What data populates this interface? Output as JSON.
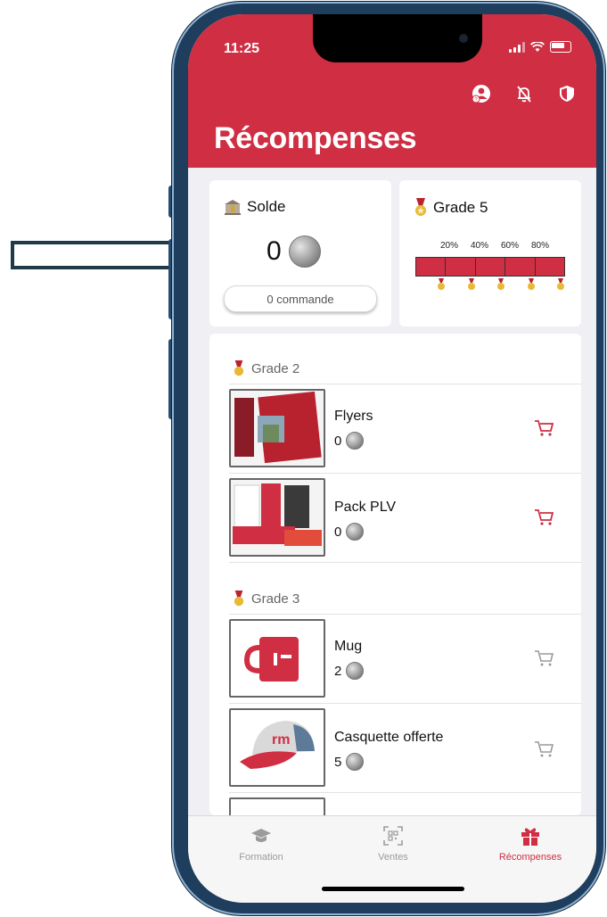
{
  "status_bar": {
    "time": "11:25"
  },
  "header": {
    "title": "Récompenses",
    "icons": [
      "help-person-icon",
      "notifications-off-icon",
      "shield-icon"
    ]
  },
  "solde_card": {
    "label": "Solde",
    "balance": "0",
    "orders_button": "0 commande"
  },
  "grade_card": {
    "label": "Grade 5",
    "percent_labels": [
      "20%",
      "40%",
      "60%",
      "80%"
    ],
    "progress_fraction": 1.0
  },
  "groups": [
    {
      "label": "Grade 2",
      "products": [
        {
          "name": "Flyers",
          "price": "0",
          "cart_active": true
        },
        {
          "name": "Pack PLV",
          "price": "0",
          "cart_active": true
        }
      ]
    },
    {
      "label": "Grade 3",
      "products": [
        {
          "name": "Mug",
          "price": "2",
          "cart_active": false
        },
        {
          "name": "Casquette offerte",
          "price": "5",
          "cart_active": false
        }
      ]
    }
  ],
  "tabbar": {
    "tabs": [
      {
        "label": "Formation",
        "icon": "graduation-cap-icon",
        "active": false
      },
      {
        "label": "Ventes",
        "icon": "qr-code-icon",
        "active": false
      },
      {
        "label": "Récompenses",
        "icon": "gift-icon",
        "active": true
      }
    ]
  },
  "colors": {
    "accent": "#cf2e43",
    "background": "#efeff4",
    "frame": "#1f3d5c",
    "annotation_arrow": "#1d3b48"
  }
}
